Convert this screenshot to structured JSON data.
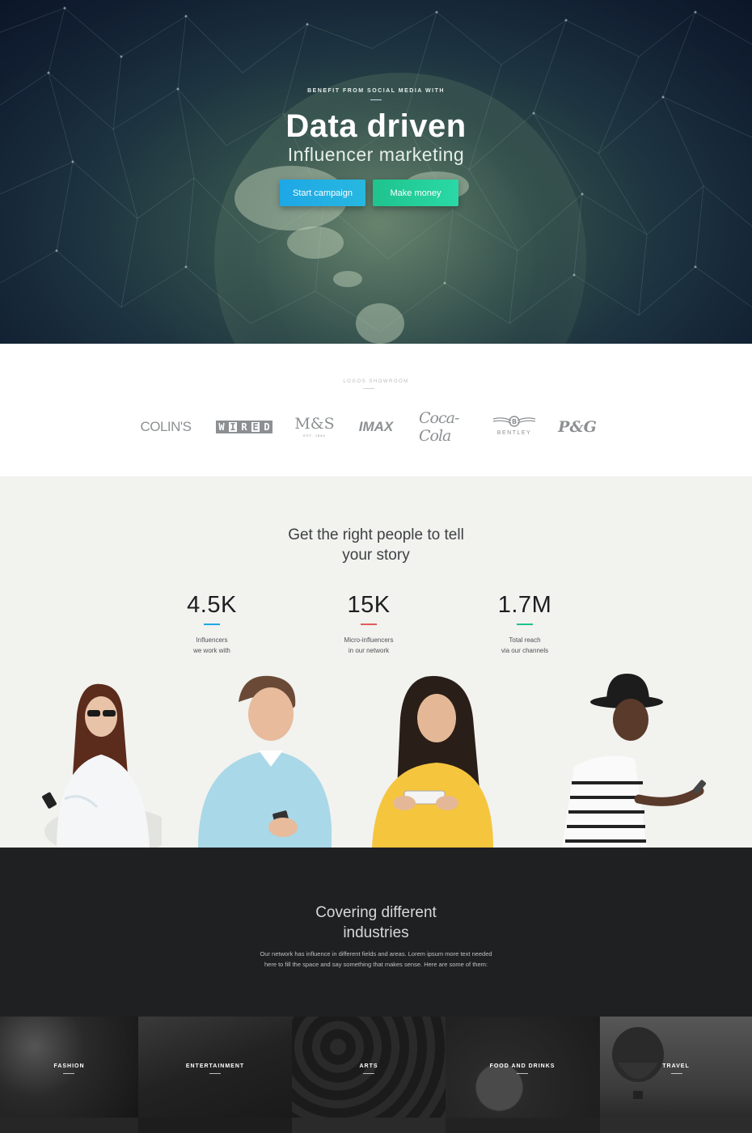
{
  "hero": {
    "kicker": "BENEFIT FROM SOCIAL MEDIA WITH",
    "title": "Data driven",
    "subtitle": "Influencer marketing",
    "buttons": {
      "campaign": "Start campaign",
      "money": "Make money"
    }
  },
  "logos": {
    "label": "LOGOS SHOWROOM",
    "items": {
      "colins": "COLIN'S",
      "wired": [
        "W",
        "I",
        "R",
        "E",
        "D"
      ],
      "ms": "M&S",
      "ms_sub": "EST. 1884",
      "imax": "IMAX",
      "coke": "Coca-Cola",
      "bentley": "BENTLEY",
      "pg": "P&G"
    }
  },
  "stats": {
    "title_line1": "Get the right people to tell",
    "title_line2": "your story",
    "items": [
      {
        "value": "4.5K",
        "label1": "Influencers",
        "label2": "we work with",
        "color": "#1ea7e6"
      },
      {
        "value": "15K",
        "label1": "Micro-influencers",
        "label2": "in our network",
        "color": "#e25b5b"
      },
      {
        "value": "1.7M",
        "label1": "Total reach",
        "label2": "via our channels",
        "color": "#1fc38d"
      }
    ]
  },
  "industries": {
    "title_line1": "Covering different",
    "title_line2": "industries",
    "description": "Our network has influence in different fields and areas. Lorem ipsum more text needed here to fill the space and say something that makes sense. Here are some of them:",
    "tiles": [
      "FASHION",
      "ENTERTAINMENT",
      "ARTS",
      "FOOD AND DRINKS",
      "TRAVEL"
    ]
  },
  "colors": {
    "accent_blue": "#1ea7e6",
    "accent_green": "#1fc38d",
    "accent_red": "#e25b5b",
    "dark_bg": "#1f2022",
    "light_bg": "#f2f2ef"
  }
}
